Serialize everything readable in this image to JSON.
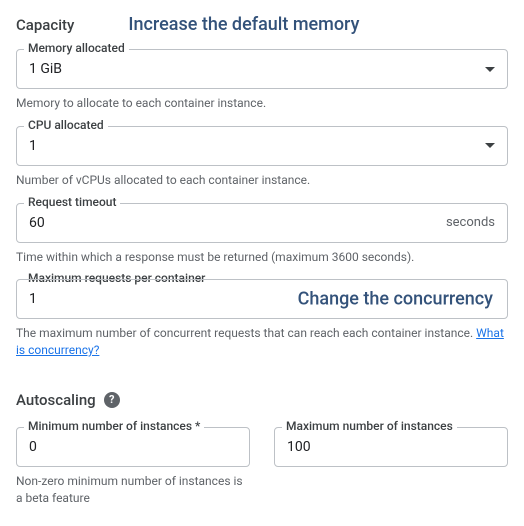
{
  "capacity": {
    "title": "Capacity",
    "memory_annotation": "Increase the default memory",
    "memory": {
      "label": "Memory allocated",
      "value": "1 GiB",
      "helper": "Memory to allocate to each container instance."
    },
    "cpu": {
      "label": "CPU allocated",
      "value": "1",
      "helper": "Number of vCPUs allocated to each container instance."
    },
    "timeout": {
      "label": "Request timeout",
      "value": "60",
      "suffix": "seconds",
      "helper": "Time within which a response must be returned (maximum 3600 seconds)."
    },
    "max_requests": {
      "label": "Maximum requests per container",
      "value": "1",
      "annotation": "Change the concurrency",
      "helper": "The maximum number of concurrent requests that can reach each container instance. ",
      "link": "What is concurrency?"
    }
  },
  "autoscaling": {
    "title": "Autoscaling",
    "help_glyph": "?",
    "min": {
      "label": "Minimum number of instances *",
      "value": "0",
      "helper": "Non-zero minimum number of instances is a beta feature"
    },
    "max": {
      "label": "Maximum number of instances",
      "value": "100"
    }
  }
}
